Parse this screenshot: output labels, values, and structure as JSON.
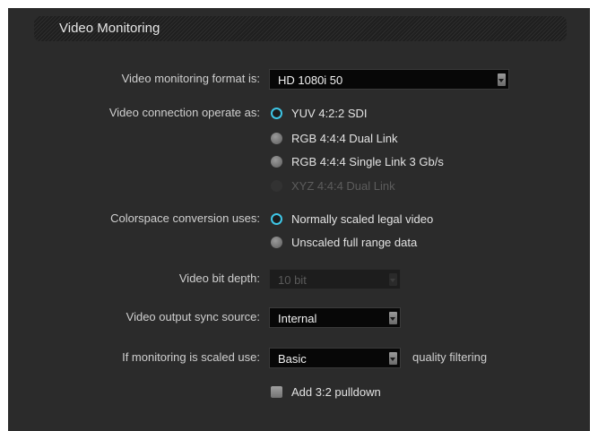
{
  "section": {
    "title": "Video Monitoring"
  },
  "monitoring_format": {
    "label": "Video monitoring format is:",
    "value": "HD 1080i 50"
  },
  "connection": {
    "label": "Video connection operate as:",
    "options": [
      {
        "label": "YUV 4:2:2 SDI",
        "selected": true,
        "enabled": true
      },
      {
        "label": "RGB 4:4:4 Dual Link",
        "selected": false,
        "enabled": true
      },
      {
        "label": "RGB 4:4:4 Single Link 3 Gb/s",
        "selected": false,
        "enabled": true
      },
      {
        "label": "XYZ 4:4:4 Dual Link",
        "selected": false,
        "enabled": false
      }
    ]
  },
  "colorspace": {
    "label": "Colorspace conversion uses:",
    "options": [
      {
        "label": "Normally scaled legal video",
        "selected": true,
        "enabled": true
      },
      {
        "label": "Unscaled full range data",
        "selected": false,
        "enabled": true
      }
    ]
  },
  "bit_depth": {
    "label": "Video bit depth:",
    "value": "10 bit",
    "enabled": false
  },
  "sync_source": {
    "label": "Video output sync source:",
    "value": "Internal"
  },
  "scaled_use": {
    "label": "If monitoring is scaled use:",
    "value": "Basic",
    "suffix": "quality filtering"
  },
  "pulldown": {
    "label": "Add 3:2 pulldown",
    "checked": false
  },
  "colors": {
    "panel_bg": "#2b2b2b",
    "selected_radio": "#3ec6e6",
    "dropdown_bg": "#070707",
    "text": "#e2e2e2",
    "disabled_text": "#5c5c5c"
  }
}
